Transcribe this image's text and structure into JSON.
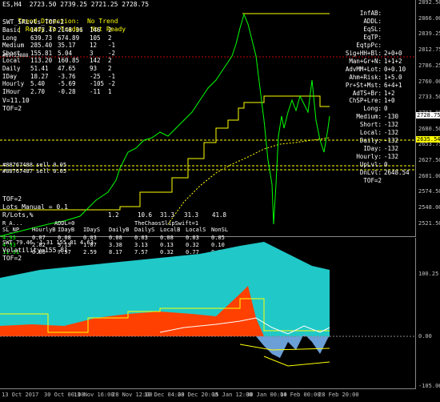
{
  "window": {
    "title": "ES,H4  2723.50 2739.25 2721.25 2728.75",
    "corner_label": "SMTv3_Esp"
  },
  "status_line": {
    "trend": "Trend Direction:  No Trend",
    "ready": "| Ready To Trade:  Not Ready"
  },
  "srl_label": "SWT_SRLvls_TOF=2",
  "stats_rows": [
    [
      "Basic",
      "1473.47",
      "2148.36",
      "146",
      "2"
    ],
    [
      "Long",
      "639.73",
      "674.89",
      "105",
      "2"
    ],
    [
      "Medium",
      "285.40",
      "35.17",
      "12",
      "-1"
    ],
    [
      "Short",
      "155.81",
      "5.04",
      "3",
      "-2"
    ],
    [
      "Local",
      "113.20",
      "160.85",
      "142",
      "2"
    ],
    [
      "Daily",
      "51.41",
      "47.65",
      "93",
      "2"
    ],
    [
      "IDay",
      "18.27",
      "-3.76",
      "-25",
      "-1"
    ],
    [
      "Hourly",
      "5.40",
      "-5.69",
      "-105",
      "-2"
    ],
    [
      "IHour",
      "2.70",
      "-0.28",
      "-11",
      "1"
    ]
  ],
  "v_label": "V=11.10",
  "tof_label_1": "TOF=2",
  "right_labels": [
    {
      "label": "InfAB:",
      "value": ""
    },
    {
      "label": "ADDL:",
      "value": ""
    },
    {
      "label": "EqSL:",
      "value": ""
    },
    {
      "label": "EqTP:",
      "value": ""
    },
    {
      "label": "EqtpPc:",
      "value": ""
    },
    {
      "label": "Sig+HH+Bl:",
      "value": "2+0+0"
    },
    {
      "label": "Man+Gr+N:",
      "value": "1+1+2"
    },
    {
      "label": "AdvMM+Lot:",
      "value": "0+0.10"
    },
    {
      "label": "Ahm+Risk:",
      "value": "1+5.0"
    },
    {
      "label": "Pr+St+Mst:",
      "value": "6+4+1"
    },
    {
      "label": "AdTS+Br:",
      "value": "1+2"
    },
    {
      "label": "ChSP+Lre:",
      "value": "1+0"
    },
    {
      "label": "Long:",
      "value": "0"
    },
    {
      "label": "Medium:",
      "value": "-130"
    },
    {
      "label": "Short:",
      "value": "-132"
    },
    {
      "label": "Local:",
      "value": "-132"
    },
    {
      "label": "Daily:",
      "value": "-132"
    },
    {
      "label": "IDay:",
      "value": "-132"
    },
    {
      "label": "Hourly:",
      "value": "-132"
    },
    {
      "label": "UpLvl:",
      "value": "0"
    },
    {
      "label": "DnLvl:",
      "value": "2648.54"
    },
    {
      "label": "TOF=2",
      "value": ""
    }
  ],
  "level_labels": [
    {
      "text": "#88767488 sell 0.05"
    },
    {
      "text": "#88767487 sell 0.05"
    }
  ],
  "mid_label": "#89723888",
  "bottom_block": {
    "tof": "TOF=2",
    "lots": "Lots_Manual = 0.1",
    "rlots_label": "R/Lots,%",
    "rlots_values": [
      "1.2",
      "10.6",
      "31.3",
      "31.3",
      "41.8"
    ],
    "header1": "R_A...",
    "addl": "ADDL=0",
    "chaos": "TheChaosSlipSwift=1",
    "header_row": [
      "SL_NP",
      "HourlyB",
      "IDayB",
      "IDayS",
      "DailyB",
      "DailyS",
      "LocalB",
      "LocalS",
      "NonSL"
    ],
    "rows": [
      [
        "4.93",
        "0.07",
        "0.08",
        "0.03",
        "0.08",
        "0.03",
        "0.08",
        "0.03",
        "0.05"
      ],
      [
        "4.93",
        "2.82",
        "3.13",
        "1.07",
        "3.38",
        "3.13",
        "0.13",
        "0.32",
        "0.10"
      ],
      [
        "11.91",
        "6.80",
        "7.57",
        "2.59",
        "8.17",
        "7.57",
        "0.32",
        "0.77",
        "0.24"
      ]
    ]
  },
  "price_axis": [
    "2892.50",
    "2866.00",
    "2839.25",
    "2812.75",
    "2786.25",
    "2760.00",
    "2733.50",
    "2707.00",
    "2680.50",
    "2653.75",
    "2627.50",
    "2601.00",
    "2574.50",
    "2548.00",
    "2521.50"
  ],
  "price_markers": {
    "current": "2728.75",
    "dn_level": "2635.54"
  },
  "indicator": {
    "title": "SWT 79.46 -1.31 155.81 4.63",
    "volatility": "Volatility=155.81",
    "tof": "TOF=2",
    "axis": [
      "100.25",
      "0.00",
      "-105.06"
    ]
  },
  "time_axis": [
    "13 Oct 2017",
    "30 Oct 00:00",
    "13 Nov 16:00",
    "28 Nov 12:00",
    "13 Dec 04:00",
    "28 Dec 20:00",
    "15 Jan 12:00",
    "30 Jan 00:00",
    "14 Feb 00:00",
    "28 Feb 20:00"
  ],
  "colors": {
    "background": "#000000",
    "candles": "#00ff00",
    "levels": "#ffff00",
    "indicator_fill": "#20c8c8",
    "indicator_accent": "#ff4000",
    "indicator_blue": "#6a9fd8"
  }
}
